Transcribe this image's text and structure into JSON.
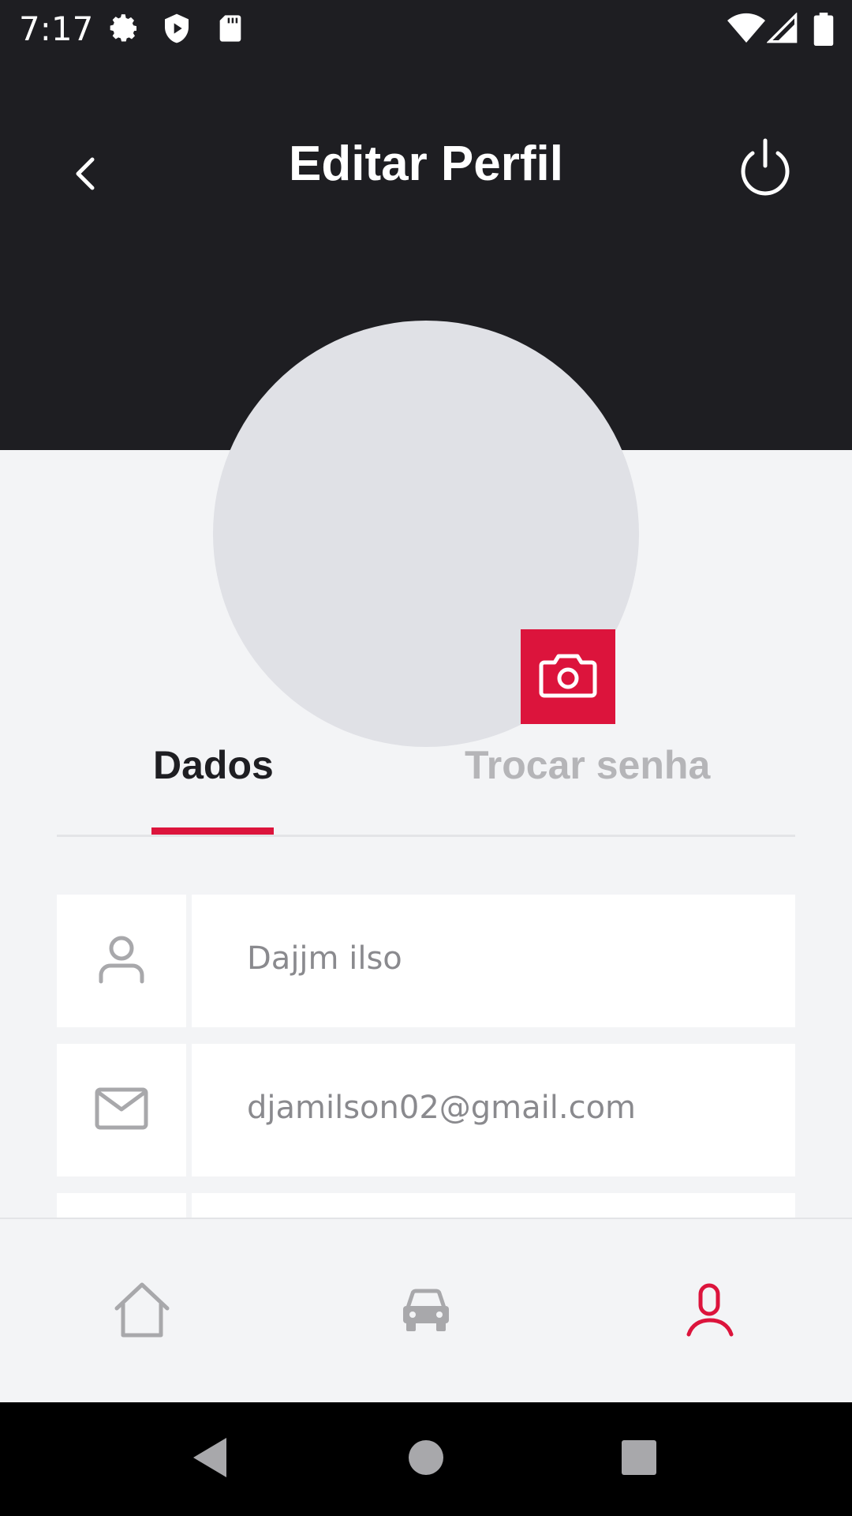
{
  "status_bar": {
    "time": "7:17",
    "left_icons": [
      "gear-icon",
      "shield-play-icon",
      "sd-card-icon"
    ],
    "right_icons": [
      "wifi-icon",
      "cellular-signal-icon",
      "battery-icon"
    ]
  },
  "header": {
    "title": "Editar Perfil",
    "back_icon": "chevron-left-icon",
    "power_icon": "power-icon"
  },
  "avatar": {
    "camera_icon": "camera-icon"
  },
  "tabs": [
    {
      "label": "Dados",
      "active": true
    },
    {
      "label": "Trocar senha",
      "active": false
    }
  ],
  "fields": [
    {
      "icon": "user-icon",
      "value": "Dajjm ilso"
    },
    {
      "icon": "mail-icon",
      "value": "djamilson02@gmail.com"
    }
  ],
  "bottom_nav": [
    {
      "icon": "home-icon",
      "active": false
    },
    {
      "icon": "car-icon",
      "active": false
    },
    {
      "icon": "profile-icon",
      "active": true
    }
  ],
  "colors": {
    "accent": "#dc143c",
    "header_bg": "#1e1e22",
    "page_bg": "#f3f4f6",
    "avatar_placeholder": "#e0e1e6",
    "inactive_icon": "#a8a8ab"
  }
}
